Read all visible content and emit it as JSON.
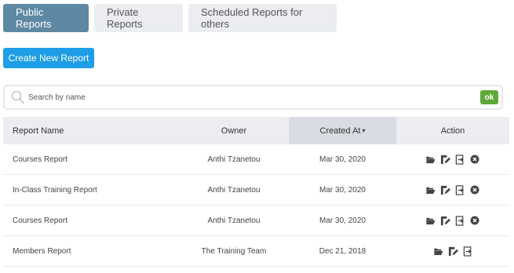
{
  "tabs": [
    {
      "label": "Public Reports",
      "active": true
    },
    {
      "label": "Private Reports",
      "active": false
    },
    {
      "label": "Scheduled Reports for others",
      "active": false
    }
  ],
  "create_button": {
    "label": "Create New Report"
  },
  "search": {
    "placeholder": "Search by name",
    "value": "",
    "ok_label": "ok"
  },
  "table": {
    "columns": {
      "name": "Report Name",
      "owner": "Owner",
      "created": "Created At",
      "action": "Action"
    },
    "sort_indicator": "▾",
    "rows": [
      {
        "name": "Courses Report",
        "owner": "Anthi Tzanetou",
        "created": "Mar 30, 2020",
        "deletable": true
      },
      {
        "name": "In-Class Training Report",
        "owner": "Anthi Tzanetou",
        "created": "Mar 30, 2020",
        "deletable": true
      },
      {
        "name": "Courses Report",
        "owner": "Anthi Tzanetou",
        "created": "Mar 30, 2020",
        "deletable": true
      },
      {
        "name": "Members Report",
        "owner": "The Training Team",
        "created": "Dec 21, 2018",
        "deletable": false
      }
    ]
  },
  "colors": {
    "active_tab": "#5e88a3",
    "primary_button": "#1d9ee6",
    "ok_button": "#5fa83a",
    "header_bg": "#ebedf0"
  },
  "icons": {
    "open": "folder-open-icon",
    "edit": "edit-icon",
    "export": "export-icon",
    "delete": "delete-icon",
    "search": "search-icon"
  }
}
